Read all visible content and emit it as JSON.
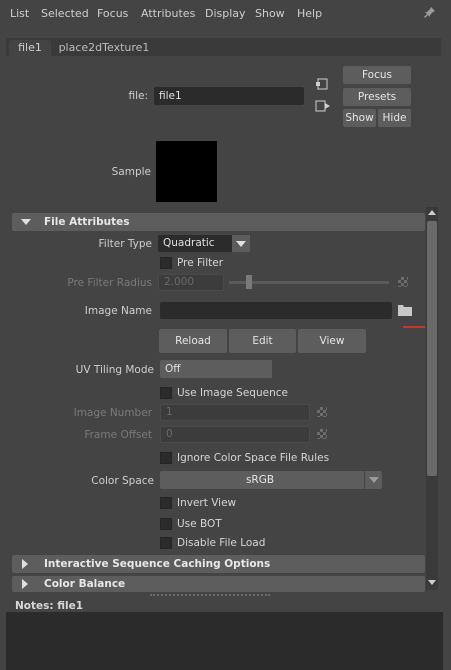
{
  "menu": [
    "List",
    "Selected",
    "Focus",
    "Attributes",
    "Display",
    "Show",
    "Help"
  ],
  "tabs": [
    {
      "label": "file1",
      "active": true
    },
    {
      "label": "place2dTexture1",
      "active": false
    }
  ],
  "node": {
    "label": "file:",
    "value": "file1",
    "focus_label": "Focus",
    "presets_label": "Presets",
    "show_label": "Show",
    "hide_label": "Hide"
  },
  "sample": {
    "label": "Sample"
  },
  "file_attributes": {
    "header": "File Attributes",
    "filter_type_label": "Filter Type",
    "filter_type_value": "Quadratic",
    "pre_filter_label": "Pre Filter",
    "pre_filter_radius_label": "Pre Filter Radius",
    "pre_filter_radius_value": "2.000",
    "image_name_label": "Image Name",
    "image_name_value": "",
    "reload_label": "Reload",
    "edit_label": "Edit",
    "view_label": "View",
    "uv_tiling_label": "UV Tiling Mode",
    "uv_tiling_value": "Off",
    "use_image_sequence_label": "Use Image Sequence",
    "image_number_label": "Image Number",
    "image_number_value": "1",
    "frame_offset_label": "Frame Offset",
    "frame_offset_value": "0",
    "ignore_cs_label": "Ignore Color Space File Rules",
    "color_space_label": "Color Space",
    "color_space_value": "sRGB",
    "invert_view_label": "Invert View",
    "use_bot_label": "Use BOT",
    "disable_file_load_label": "Disable File Load"
  },
  "sections_collapsed": [
    "Interactive Sequence Caching Options",
    "Color Balance"
  ],
  "notes": {
    "label": "Notes:",
    "value": "file1"
  },
  "colors": {
    "background": "#444444",
    "field": "#2b2b2b",
    "section": "#5d5d5d",
    "accent_red": "#c0392b"
  }
}
